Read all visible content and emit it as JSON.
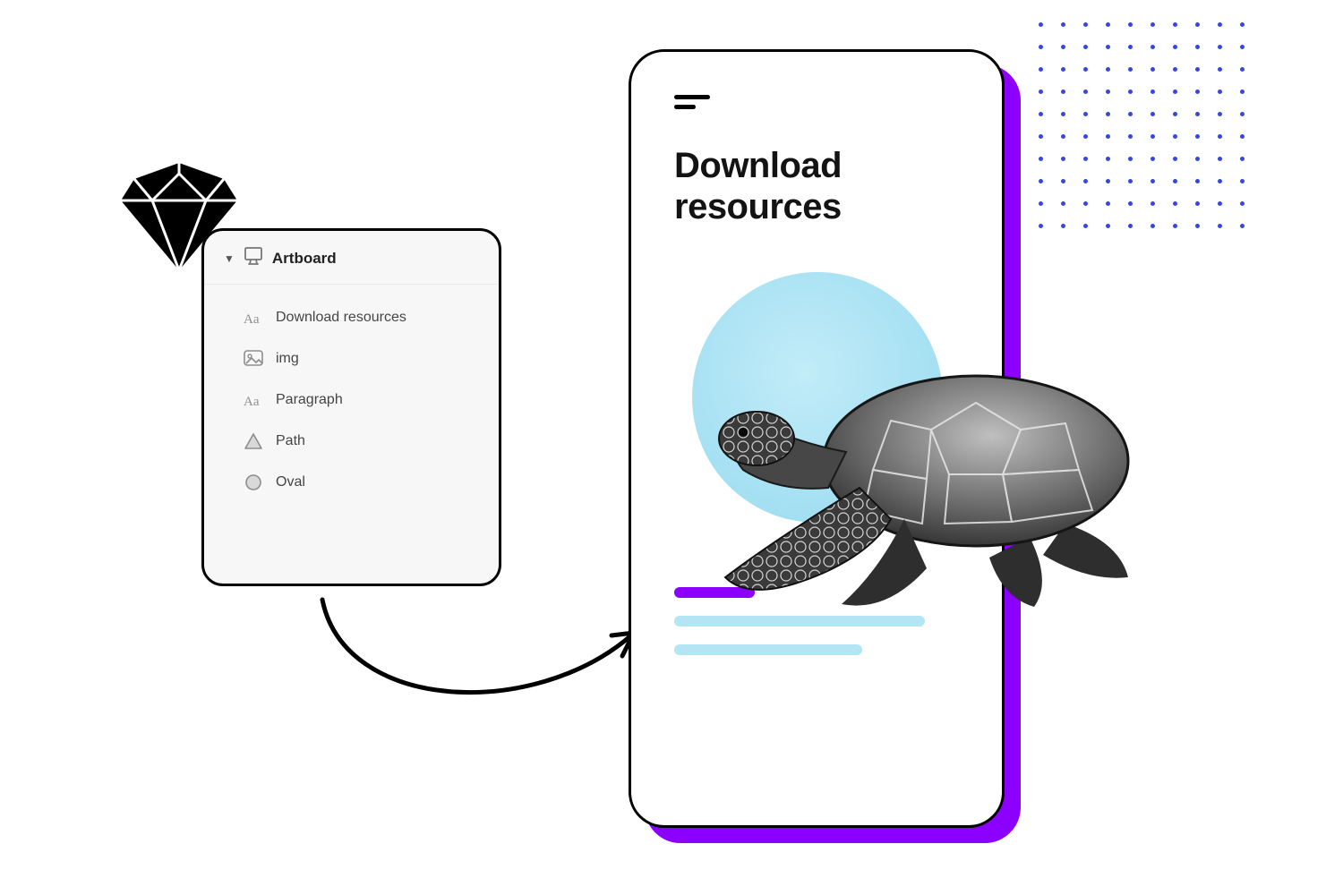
{
  "panel": {
    "header": "Artboard",
    "layers": [
      {
        "icon": "text-icon",
        "label": "Download resources"
      },
      {
        "icon": "image-icon",
        "label": "img"
      },
      {
        "icon": "text-icon",
        "label": "Paragraph"
      },
      {
        "icon": "path-icon",
        "label": "Path"
      },
      {
        "icon": "oval-icon",
        "label": "Oval"
      }
    ]
  },
  "phone": {
    "title_line1": "Download",
    "title_line2": "resources"
  },
  "colors": {
    "accent_purple": "#8b00ff",
    "accent_lightblue": "#b3e5f5",
    "dot_blue": "#3647e1",
    "hero_circle": "#ace3f4"
  }
}
